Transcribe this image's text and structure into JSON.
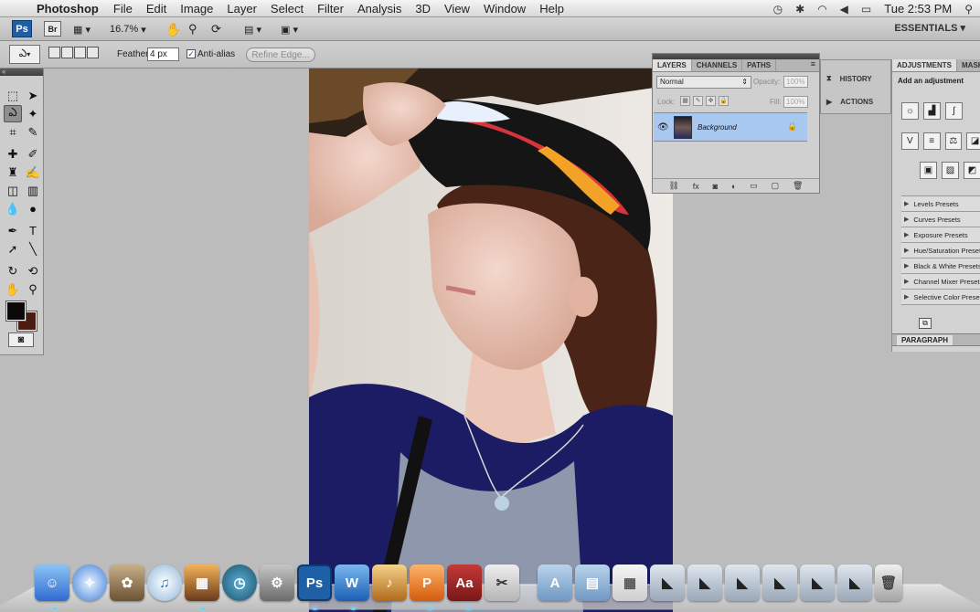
{
  "menubar": {
    "app_name": "Photoshop",
    "menus": [
      "File",
      "Edit",
      "Image",
      "Layer",
      "Select",
      "Filter",
      "Analysis",
      "3D",
      "View",
      "Window",
      "Help"
    ],
    "clock": "Tue 2:53 PM"
  },
  "appbar": {
    "ps": "Ps",
    "br": "Br",
    "zoom": "16.7%",
    "workspace": "ESSENTIALS"
  },
  "options": {
    "feather_label": "Feather:",
    "feather_value": "4 px",
    "antialias_label": "Anti-alias",
    "refine_edge": "Refine Edge..."
  },
  "layers": {
    "tabs": [
      "LAYERS",
      "CHANNELS",
      "PATHS"
    ],
    "blend_mode": "Normal",
    "opacity_label": "Opacity:",
    "opacity_value": "100%",
    "lock_label": "Lock:",
    "fill_label": "Fill:",
    "fill_value": "100%",
    "layer_name": "Background"
  },
  "strip": {
    "history": "HISTORY",
    "actions": "ACTIONS"
  },
  "adjustments": {
    "tabs": [
      "ADJUSTMENTS",
      "MASKS"
    ],
    "title": "Add an adjustment",
    "presets": [
      "Levels Presets",
      "Curves Presets",
      "Exposure Presets",
      "Hue/Saturation Presets",
      "Black & White Presets",
      "Channel Mixer Presets",
      "Selective Color Presets"
    ],
    "paragraph": "PARAGRAPH"
  },
  "colors": {
    "foreground": "#0c0a09",
    "background": "#4a1c12",
    "layer_selected": "#a9c8ef",
    "ps_blue": "#1f5fa5"
  },
  "dock": {
    "ps_label": "Ps",
    "dictionary_label": "Aa"
  }
}
